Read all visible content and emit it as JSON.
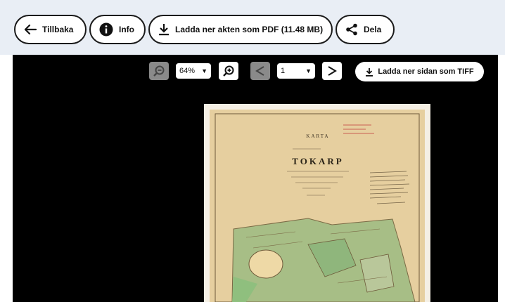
{
  "top_actions": {
    "back_label": "Tillbaka",
    "info_label": "Info",
    "download_pdf_label": "Ladda ner akten som PDF (11.48 MB)",
    "share_label": "Dela"
  },
  "viewer_toolbar": {
    "zoom_value": "64%",
    "page_value": "1",
    "download_tiff_label": "Ladda ner sidan som TIFF"
  },
  "map_document": {
    "heading": "KARTA",
    "place_name": "TOKARP"
  },
  "colors": {
    "topbar_bg": "#e9eef5",
    "viewer_bg": "#000000",
    "paper": "#e8d2a6",
    "land_green": "#9bbd86"
  }
}
